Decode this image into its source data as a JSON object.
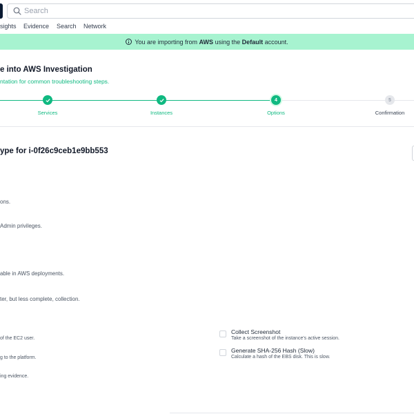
{
  "search": {
    "placeholder": "Search"
  },
  "nav": {
    "items": [
      "sights",
      "Evidence",
      "Search",
      "Network"
    ]
  },
  "banner": {
    "pre": "You are importing from",
    "source": "AWS",
    "mid": "using the",
    "account": "Default",
    "post": "account."
  },
  "page": {
    "title": "e into AWS Investigation",
    "subtitle": "ntation for common troubleshooting steps."
  },
  "stepper": {
    "steps": [
      {
        "number": "",
        "label": "Services",
        "state": "done"
      },
      {
        "number": "",
        "label": "Instances",
        "state": "done"
      },
      {
        "number": "4",
        "label": "Options",
        "state": "active"
      },
      {
        "number": "5",
        "label": "Confirmation",
        "state": "pending"
      }
    ],
    "colors": {
      "complete": "#10b981",
      "pending": "#e5e7eb"
    }
  },
  "section": {
    "title": "ype for i-0f26c9ceb1e9bb553",
    "lines": [
      "ons.",
      "Admin privileges.",
      "able in AWS deployments.",
      "ter, but less complete, collection.",
      "of the EC2 user.",
      "g to the platform.",
      "ing evidence."
    ]
  },
  "options": [
    {
      "title": "Collect Screenshot",
      "description": "Take a screenshot of the instance's active session.",
      "checked": false
    },
    {
      "title": "Generate SHA-256 Hash (Slow)",
      "description": "Calculate a hash of the EBS disk. This is slow.",
      "checked": false
    }
  ],
  "icons": {
    "search": "search-icon",
    "info": "info-icon",
    "check": "check-icon"
  }
}
